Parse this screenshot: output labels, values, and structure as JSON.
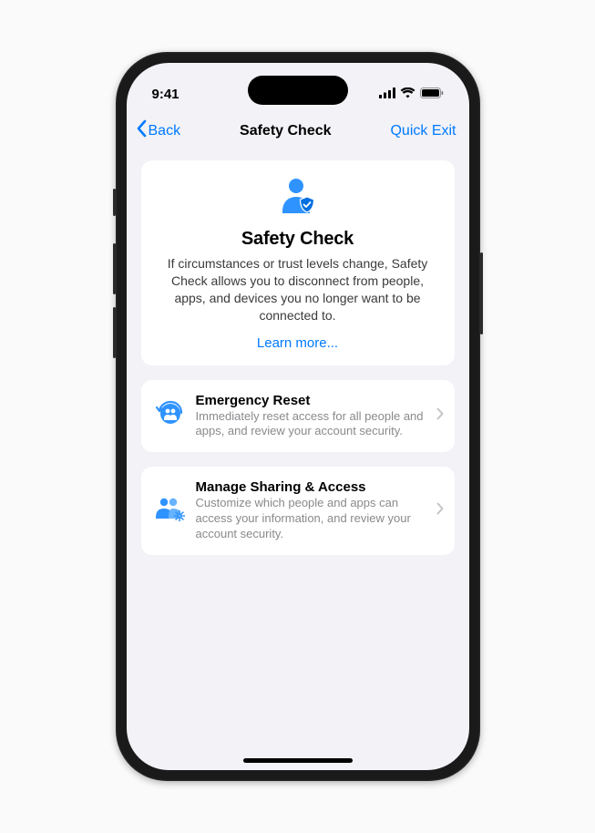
{
  "status": {
    "time": "9:41"
  },
  "nav": {
    "back_label": "Back",
    "title": "Safety Check",
    "quick_exit": "Quick Exit"
  },
  "hero": {
    "title": "Safety Check",
    "description": "If circumstances or trust levels change, Safety Check allows you to disconnect from people, apps, and devices you no longer want to be connected to.",
    "learn_more": "Learn more..."
  },
  "options": {
    "emergency": {
      "title": "Emergency Reset",
      "description": "Immediately reset access for all people and apps, and review your account security."
    },
    "manage": {
      "title": "Manage Sharing & Access",
      "description": "Customize which people and apps can access your information, and review your account security."
    }
  }
}
